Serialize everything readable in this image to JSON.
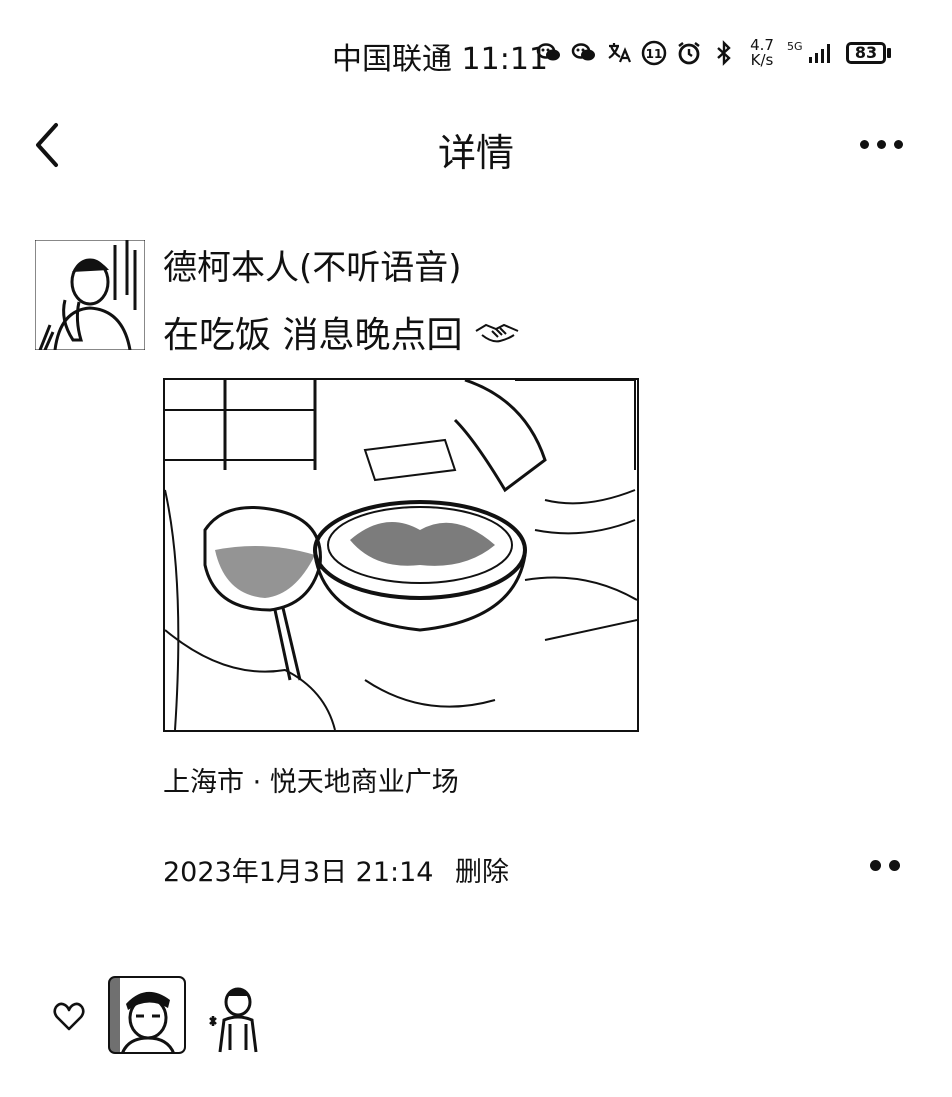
{
  "status_bar": {
    "carrier": "中国联通",
    "time": "11:11",
    "net_speed_value": "4.7",
    "net_speed_unit": "K/s",
    "network": "5G",
    "battery": "83",
    "icons": [
      "wechat-icon",
      "wechat-icon",
      "translate-icon",
      "notification-icon",
      "alarm-icon",
      "bluetooth-icon",
      "signal-icon",
      "battery-icon"
    ]
  },
  "nav": {
    "title": "详情",
    "back_icon": "chevron-left-icon",
    "more_icon": "more-icon"
  },
  "post": {
    "username": "德柯本人(不听语音)",
    "text": "在吃饭 消息晚点回",
    "emoji": "handshake-emoji",
    "location": "上海市 · 悦天地商业广场",
    "datetime": "2023年1月3日 21:14",
    "delete_label": "删除"
  },
  "likes": {
    "icon": "heart-icon",
    "users": [
      "avatar-liker-1",
      "avatar-liker-2"
    ]
  }
}
